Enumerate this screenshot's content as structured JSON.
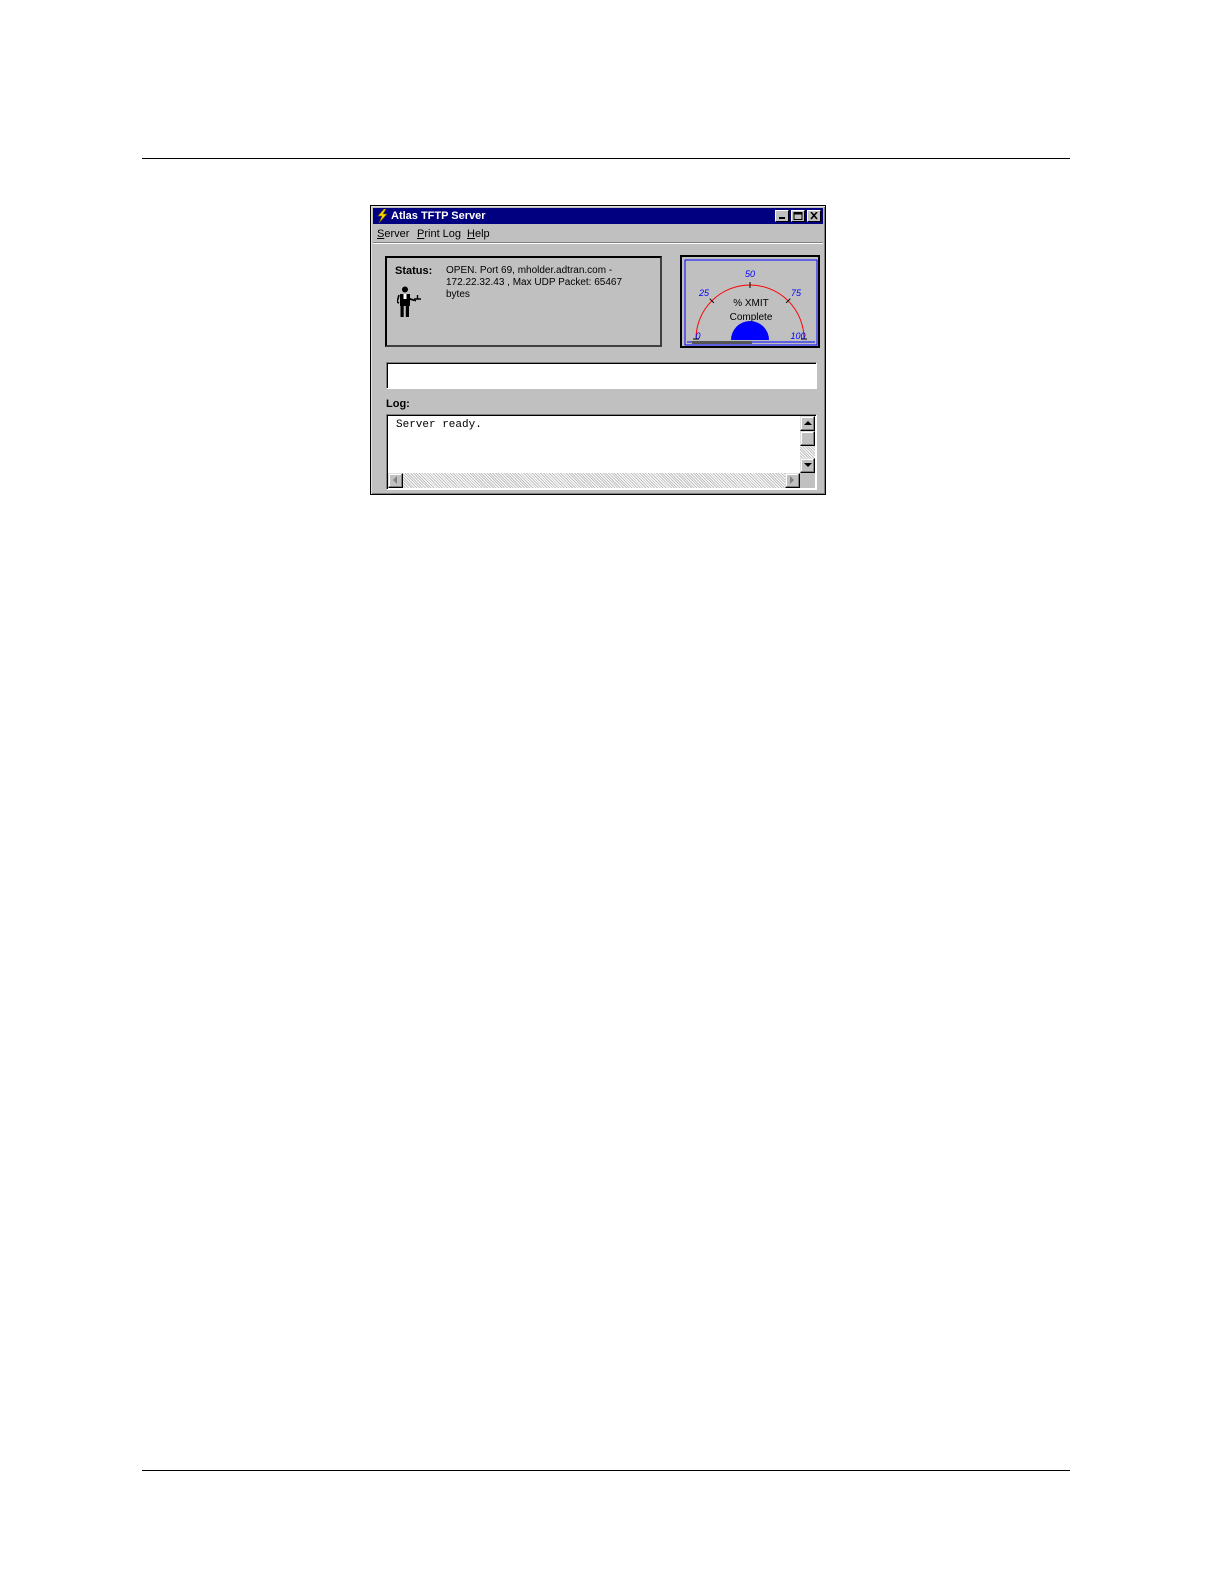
{
  "window": {
    "title": "Atlas TFTP Server"
  },
  "menu": {
    "items": [
      {
        "label_underline": "S",
        "label_rest": "erver"
      },
      {
        "label_underline": "P",
        "label_rest": "rint Log"
      },
      {
        "label_underline": "H",
        "label_rest": "elp"
      }
    ]
  },
  "status": {
    "label": "Status:",
    "text": "OPEN. Port 69, mholder.adtran.com - 172.22.32.43 , Max UDP Packet: 65467 bytes"
  },
  "gauge": {
    "ticks": [
      "0",
      "25",
      "50",
      "75",
      "100"
    ],
    "caption_line1": "% XMIT",
    "caption_line2": "Complete",
    "percent_complete": 0,
    "arc_color": "#ff0000",
    "needle_color": "#0000ff",
    "tick_color": "#0000ff"
  },
  "entry": {
    "value": ""
  },
  "log": {
    "label": "Log:",
    "lines": [
      "Server ready."
    ]
  }
}
